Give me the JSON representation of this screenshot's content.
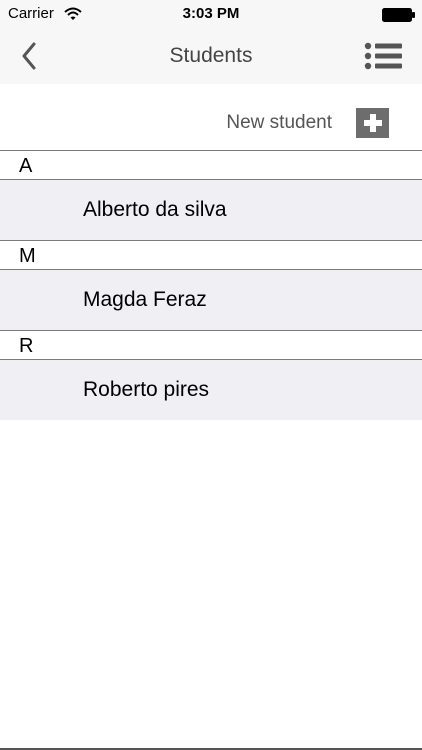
{
  "status_bar": {
    "carrier": "Carrier",
    "time": "3:03 PM",
    "wifi_icon": "wifi-icon",
    "battery_icon": "battery-icon"
  },
  "nav": {
    "title": "Students",
    "back_icon": "chevron-left-icon",
    "menu_icon": "list-icon"
  },
  "new_student": {
    "label": "New student",
    "icon": "plus-icon"
  },
  "sections": [
    {
      "letter": "A",
      "students": [
        "Alberto da silva"
      ]
    },
    {
      "letter": "M",
      "students": [
        "Magda Feraz"
      ]
    },
    {
      "letter": "R",
      "students": [
        "Roberto pires"
      ]
    }
  ],
  "colors": {
    "row_background": "#efeff4",
    "bar_background": "#f7f7f7",
    "add_button": "#6d6d6d"
  }
}
